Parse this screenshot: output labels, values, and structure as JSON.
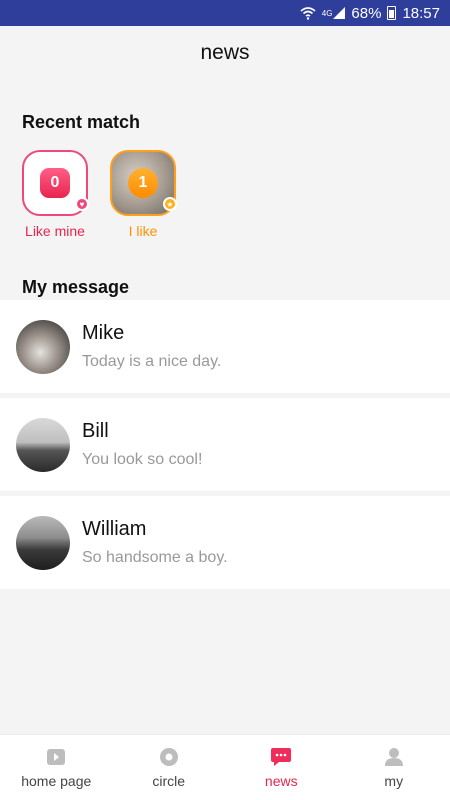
{
  "status_bar": {
    "signal": "4G",
    "battery": "68%",
    "time": "18:57"
  },
  "header": {
    "title": "news"
  },
  "recent_match": {
    "title": "Recent match",
    "items": [
      {
        "count": "0",
        "label": "Like mine",
        "icon": "heart-icon",
        "color": "#e8254f"
      },
      {
        "count": "1",
        "label": "I like",
        "icon": "star-icon",
        "color": "#ff9100"
      }
    ]
  },
  "my_message": {
    "title": "My message",
    "messages": [
      {
        "name": "Mike",
        "preview": "Today is a nice day."
      },
      {
        "name": "Bill",
        "preview": "You look so cool!"
      },
      {
        "name": "William",
        "preview": "So handsome a boy."
      }
    ]
  },
  "tab_bar": {
    "tabs": [
      {
        "label": "home page",
        "icon": "video-icon"
      },
      {
        "label": "circle",
        "icon": "circle-icon"
      },
      {
        "label": "news",
        "icon": "chat-icon",
        "active": true
      },
      {
        "label": "my",
        "icon": "person-icon"
      }
    ],
    "accent": "#e8254f"
  }
}
